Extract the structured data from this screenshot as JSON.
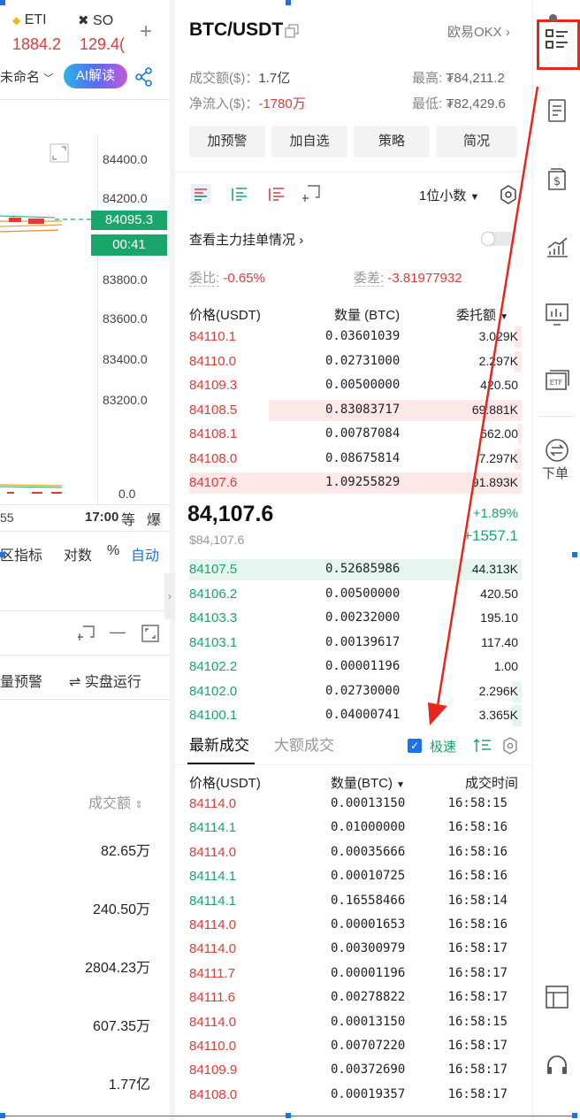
{
  "left": {
    "tabs": [
      {
        "label": "ETI",
        "value": "1884.2"
      },
      {
        "label": "SO",
        "value": "129.4("
      }
    ],
    "add": "+",
    "rename": "未命名",
    "ai_label": "AI解读",
    "y_axis": [
      "84400.0",
      "84200.0",
      "83800.0",
      "83600.0",
      "83400.0",
      "83200.0",
      "0.0"
    ],
    "price_tag": "84095.3",
    "countdown": "00:41",
    "time_label": "17:00",
    "x_left": "55",
    "btn_equal": "等",
    "btn_explode": "爆",
    "indicators": [
      "区指标",
      "对数",
      "%",
      "自动"
    ],
    "alerts": "量预警",
    "run": "实盘运行",
    "turnover_header": "成交额",
    "turnovers": [
      "82.65万",
      "240.50万",
      "2804.23万",
      "607.35万",
      "1.77亿"
    ]
  },
  "header": {
    "pair": "BTC/USDT",
    "exchange": "欧易OKX",
    "volume_label": "成交额($)：",
    "volume": "1.7亿",
    "inflow_label": "净流入($)：",
    "inflow": "-1780万",
    "high_label": "最高:",
    "high": "₮84,211.2",
    "low_label": "最低:",
    "low": "₮82,429.6"
  },
  "actions": [
    "加预警",
    "加自选",
    "策略",
    "简况"
  ],
  "decimals": "1位小数",
  "main_orders_link": "查看主力挂单情况",
  "ratio_label": "委比:",
  "ratio": "-0.65%",
  "diff_label": "委差:",
  "diff": "-3.81977932",
  "ob_headers": [
    "价格(USDT)",
    "数量 (BTC)",
    "委托额"
  ],
  "asks": [
    {
      "price": "84110.1",
      "qty": "0.03601039",
      "total": "3.029K",
      "depth": 0.02
    },
    {
      "price": "84110.0",
      "qty": "0.02731000",
      "total": "2.297K",
      "depth": 0.02
    },
    {
      "price": "84109.3",
      "qty": "0.00500000",
      "total": "420.50",
      "depth": 0.0
    },
    {
      "price": "84108.5",
      "qty": "0.83083717",
      "total": "69.881K",
      "depth": 0.76
    },
    {
      "price": "84108.1",
      "qty": "0.00787084",
      "total": "662.00",
      "depth": 0.01
    },
    {
      "price": "84108.0",
      "qty": "0.08675814",
      "total": "7.297K",
      "depth": 0.02
    },
    {
      "price": "84107.6",
      "qty": "1.09255829",
      "total": "91.893K",
      "depth": 1.0
    }
  ],
  "last_price": "84,107.6",
  "last_usd": "$84,107.6",
  "change_pct": "+1.89%",
  "change_abs": "+1557.1",
  "bids": [
    {
      "price": "84107.5",
      "qty": "0.52685986",
      "total": "44.313K",
      "depth": 1.0
    },
    {
      "price": "84106.2",
      "qty": "0.00500000",
      "total": "420.50",
      "depth": 0.0
    },
    {
      "price": "84103.3",
      "qty": "0.00232000",
      "total": "195.10",
      "depth": 0.0
    },
    {
      "price": "84103.1",
      "qty": "0.00139617",
      "total": "117.40",
      "depth": 0.0
    },
    {
      "price": "84102.2",
      "qty": "0.00001196",
      "total": "1.00",
      "depth": 0.0
    },
    {
      "price": "84102.0",
      "qty": "0.02730000",
      "total": "2.296K",
      "depth": 0.03
    },
    {
      "price": "84100.1",
      "qty": "0.04000741",
      "total": "3.365K",
      "depth": 0.03
    }
  ],
  "trade_tabs": [
    "最新成交",
    "大额成交"
  ],
  "fast_label": "极速",
  "trade_headers": [
    "价格(USDT)",
    "数量(BTC)",
    "成交时间"
  ],
  "trades": [
    {
      "price": "84114.0",
      "qty": "0.00013150",
      "time": "16:58:15",
      "side": "sell"
    },
    {
      "price": "84114.1",
      "qty": "0.01000000",
      "time": "16:58:16",
      "side": "buy"
    },
    {
      "price": "84114.0",
      "qty": "0.00035666",
      "time": "16:58:16",
      "side": "sell"
    },
    {
      "price": "84114.1",
      "qty": "0.00010725",
      "time": "16:58:16",
      "side": "buy"
    },
    {
      "price": "84114.1",
      "qty": "0.16558466",
      "time": "16:58:14",
      "side": "buy"
    },
    {
      "price": "84114.0",
      "qty": "0.00001653",
      "time": "16:58:16",
      "side": "sell"
    },
    {
      "price": "84114.0",
      "qty": "0.00300979",
      "time": "16:58:17",
      "side": "sell"
    },
    {
      "price": "84111.7",
      "qty": "0.00001196",
      "time": "16:58:17",
      "side": "sell"
    },
    {
      "price": "84111.6",
      "qty": "0.00278822",
      "time": "16:58:17",
      "side": "sell"
    },
    {
      "price": "84114.0",
      "qty": "0.00013150",
      "time": "16:58:15",
      "side": "sell"
    },
    {
      "price": "84110.0",
      "qty": "0.00707220",
      "time": "16:58:17",
      "side": "sell"
    },
    {
      "price": "84109.9",
      "qty": "0.00372690",
      "time": "16:58:17",
      "side": "sell"
    },
    {
      "price": "84108.0",
      "qty": "0.00019357",
      "time": "16:58:17",
      "side": "sell"
    }
  ],
  "rail": {
    "order_label": "下单"
  },
  "colors": {
    "up": "#1aa66a",
    "down": "#e03a3a",
    "accent": "#1a73e8",
    "annotation": "#e8261c"
  }
}
